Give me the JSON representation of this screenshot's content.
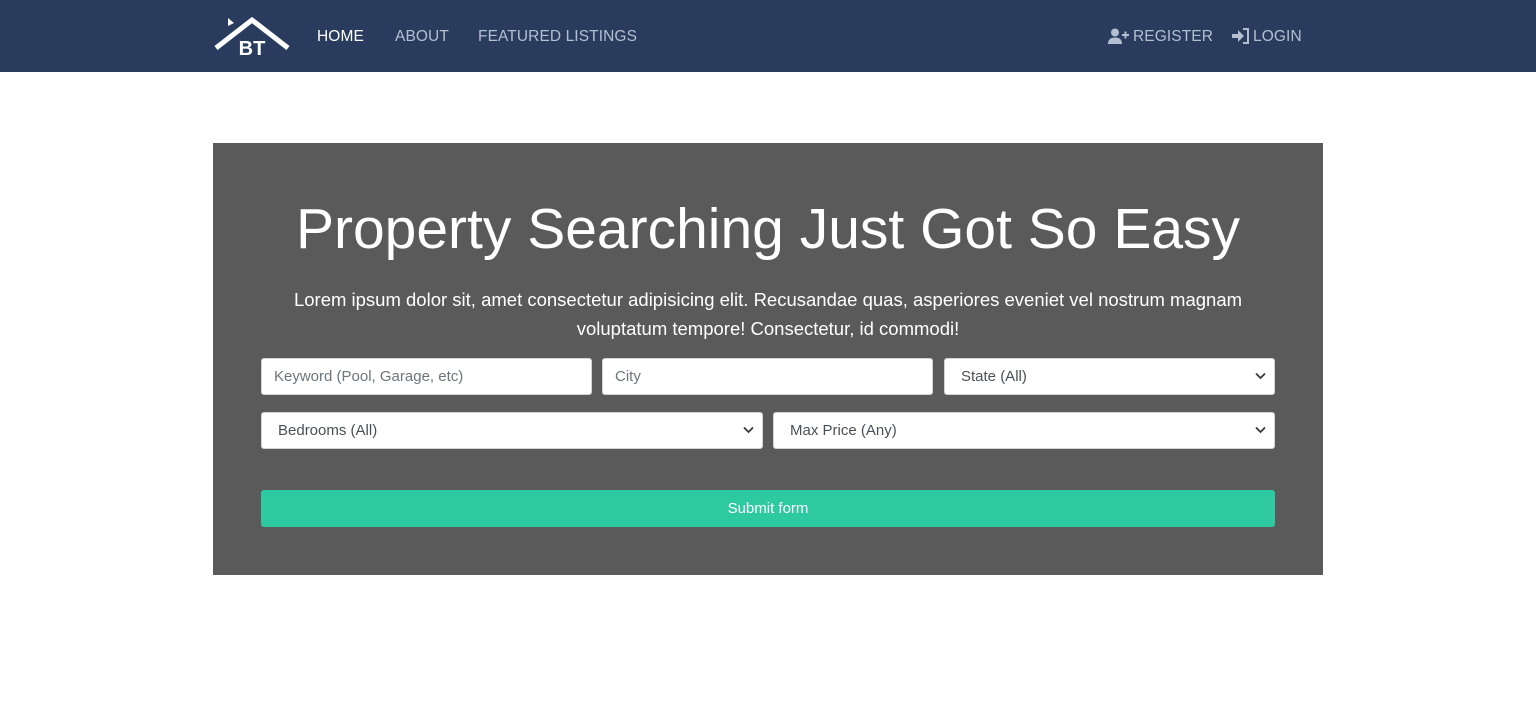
{
  "brand": {
    "logo_text": "BT"
  },
  "nav": {
    "home": "HOME",
    "about": "ABOUT",
    "featured": "FEATURED LISTINGS",
    "register": "REGISTER",
    "login": "LOGIN"
  },
  "icons": {
    "register": "user-plus-icon",
    "login": "sign-in-icon",
    "select": "chevron-down-icon"
  },
  "colors": {
    "navbar": "#293c5e",
    "hero": "#5a5a5a",
    "accent": "#2dc9a0"
  },
  "hero": {
    "title": "Property Searching Just Got So Easy",
    "text": "Lorem ipsum dolor sit, amet consectetur adipisicing elit. Recusandae quas, asperiores eveniet vel nostrum magnam voluptatum tempore! Consectetur, id commodi!"
  },
  "form": {
    "keyword_placeholder": "Keyword (Pool, Garage, etc)",
    "city_placeholder": "City",
    "state_selected": "State (All)",
    "bedrooms_selected": "Bedrooms (All)",
    "price_selected": "Max Price (Any)",
    "submit_label": "Submit form"
  }
}
